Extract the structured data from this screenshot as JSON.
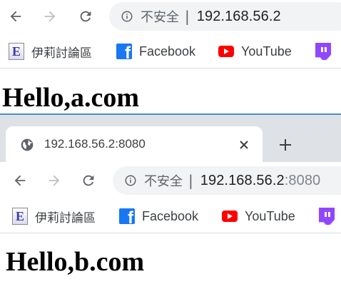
{
  "window1": {
    "omnibox": {
      "security_label": "不安全",
      "separator": "|",
      "url": "192.168.56.2"
    },
    "bookmarks": [
      {
        "label": "伊莉討論區",
        "icon": "eyny-icon"
      },
      {
        "label": "Facebook",
        "icon": "facebook-icon"
      },
      {
        "label": "YouTube",
        "icon": "youtube-icon"
      },
      {
        "label": "",
        "icon": "twitch-icon"
      }
    ],
    "page_heading": "Hello,a.com"
  },
  "window2": {
    "tab": {
      "title": "192.168.56.2:8080"
    },
    "omnibox": {
      "security_label": "不安全",
      "separator": "|",
      "url_host": "192.168.56.2",
      "url_port": ":8080"
    },
    "bookmarks": [
      {
        "label": "伊莉討論區",
        "icon": "eyny-icon"
      },
      {
        "label": "Facebook",
        "icon": "facebook-icon"
      },
      {
        "label": "YouTube",
        "icon": "youtube-icon"
      },
      {
        "label": "",
        "icon": "twitch-icon"
      }
    ],
    "page_heading": "Hello,b.com"
  },
  "colors": {
    "tabstrip": "#dee1e6",
    "omnibox": "#f1f3f4",
    "facebook": "#1877f2",
    "youtube": "#ff0000",
    "twitch": "#9146ff",
    "accent_border": "#4a90c8"
  }
}
